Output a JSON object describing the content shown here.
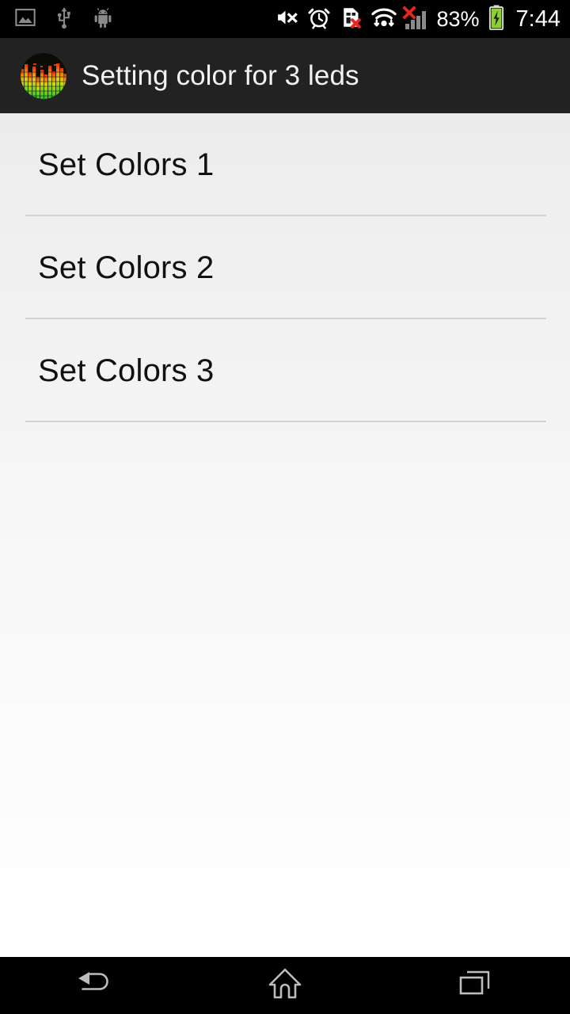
{
  "status_bar": {
    "left_icons": [
      {
        "name": "image-icon",
        "label": "Screenshot / image notification"
      },
      {
        "name": "usb-icon",
        "label": "USB connected"
      },
      {
        "name": "android-icon",
        "label": "Android system notification"
      }
    ],
    "right_icons": [
      {
        "name": "volume-mute-icon",
        "label": "Sound muted"
      },
      {
        "name": "alarm-clock-icon",
        "label": "Alarm set"
      },
      {
        "name": "sim-card-missing-icon",
        "label": "No SIM card"
      },
      {
        "name": "wifi-icon",
        "label": "Wi-Fi connected with data transfer"
      },
      {
        "name": "cellular-signal-icon",
        "label": "No cellular service"
      }
    ],
    "battery_percent": "83%",
    "battery_state": "charging",
    "time": "7:44",
    "background_color": "#000000",
    "text_color": "#ffffff",
    "icon_color": "#8a8a8a",
    "alert_color": "#e8251f"
  },
  "app_bar": {
    "icon_name": "equalizer-app-icon",
    "title": "Setting color for 3 leds",
    "background_color": "#222222",
    "title_color": "#f2f2f2"
  },
  "main": {
    "background_top_color": "#ececec",
    "background_bottom_color": "#ffffff",
    "divider_color": "#d2d2d2",
    "item_text_color": "#111111",
    "list_items": [
      {
        "label": "Set Colors 1"
      },
      {
        "label": "Set Colors 2"
      },
      {
        "label": "Set Colors 3"
      }
    ]
  },
  "nav_bar": {
    "background_color": "#000000",
    "icon_color": "#bdbdbd",
    "buttons": [
      {
        "name": "back-button",
        "label": "Back"
      },
      {
        "name": "home-button",
        "label": "Home"
      },
      {
        "name": "recents-button",
        "label": "Recent apps"
      }
    ]
  }
}
